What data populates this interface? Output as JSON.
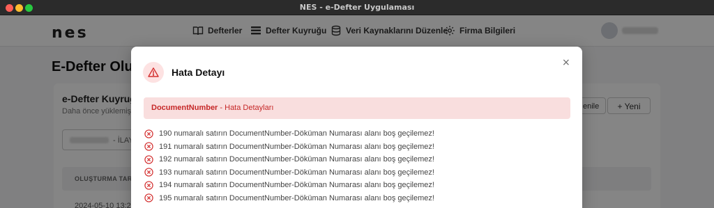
{
  "window": {
    "title": "NES - e-Defter Uygulaması"
  },
  "nav": {
    "logo": "nes",
    "items": [
      {
        "label": "Defterler",
        "icon": "book-icon"
      },
      {
        "label": "Defter Kuyruğu",
        "icon": "list-icon"
      },
      {
        "label": "Veri Kaynaklarını Düzenle",
        "icon": "database-icon"
      },
      {
        "label": "Firma Bilgileri",
        "icon": "gear-icon"
      }
    ]
  },
  "page": {
    "title": "E-Defter Oluş",
    "card_title": "e-Defter Kuyruğ",
    "card_subtitle": "Daha önce yüklemiş",
    "refresh_label": "enile",
    "new_label": "+ Yeni",
    "filter_text": "- İLAY",
    "table_header": "OLUŞTURMA TAR",
    "first_cell": "2024-05-10 13:2"
  },
  "modal": {
    "title": "Hata Detayı",
    "close": "×",
    "alert_key": "DocumentNumber",
    "alert_rest": " - Hata Detayları",
    "errors": [
      "190 numaralı satırın DocumentNumber-Döküman Numarası alanı boş geçilemez!",
      "191 numaralı satırın DocumentNumber-Döküman Numarası alanı boş geçilemez!",
      "192 numaralı satırın DocumentNumber-Döküman Numarası alanı boş geçilemez!",
      "193 numaralı satırın DocumentNumber-Döküman Numarası alanı boş geçilemez!",
      "194 numaralı satırın DocumentNumber-Döküman Numarası alanı boş geçilemez!",
      "195 numaralı satırın DocumentNumber-Döküman Numarası alanı boş geçilemez!"
    ]
  },
  "colors": {
    "error": "#d32f2f",
    "alert_bg": "#f9dede"
  }
}
